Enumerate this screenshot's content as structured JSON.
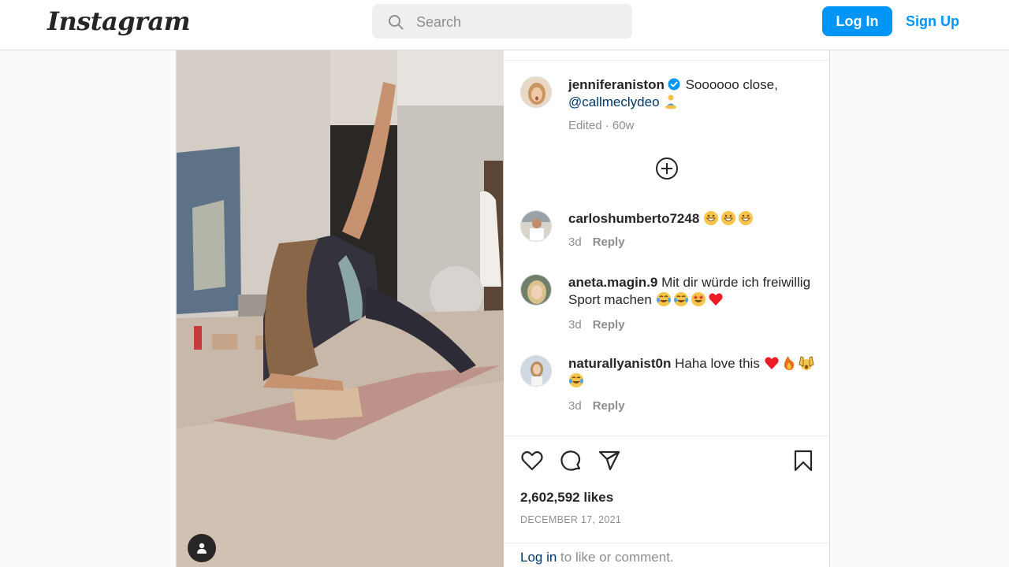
{
  "header": {
    "logo": "Instagram",
    "search_placeholder": "Search",
    "login_label": "Log In",
    "signup_label": "Sign Up"
  },
  "post": {
    "caption": {
      "username": "jenniferaniston",
      "text": "Soooooo close,",
      "mention": "@callmeclydeo",
      "meta": "Edited · 60w"
    },
    "comments": [
      {
        "username": "carloshumberto7248",
        "text": "",
        "time": "3d",
        "reply": "Reply"
      },
      {
        "username": "aneta.magin.9",
        "text": "Mit dir würde ich freiwillig Sport machen",
        "time": "3d",
        "reply": "Reply"
      },
      {
        "username": "naturallyanist0n",
        "text": "Haha love this",
        "time": "3d",
        "reply": "Reply"
      }
    ],
    "likes": "2,602,592 likes",
    "date": "DECEMBER 17, 2021",
    "login_prompt": {
      "link": "Log in",
      "text": " to like or comment."
    }
  },
  "colors": {
    "accent": "#0095f6",
    "link": "#00376b",
    "muted": "#8e8e8e",
    "heart": "#ed1c24"
  },
  "icons": [
    "search-icon",
    "verified-badge-icon",
    "load-more-comments-icon",
    "heart-icon",
    "comment-icon",
    "share-icon",
    "save-icon",
    "user-icon"
  ]
}
